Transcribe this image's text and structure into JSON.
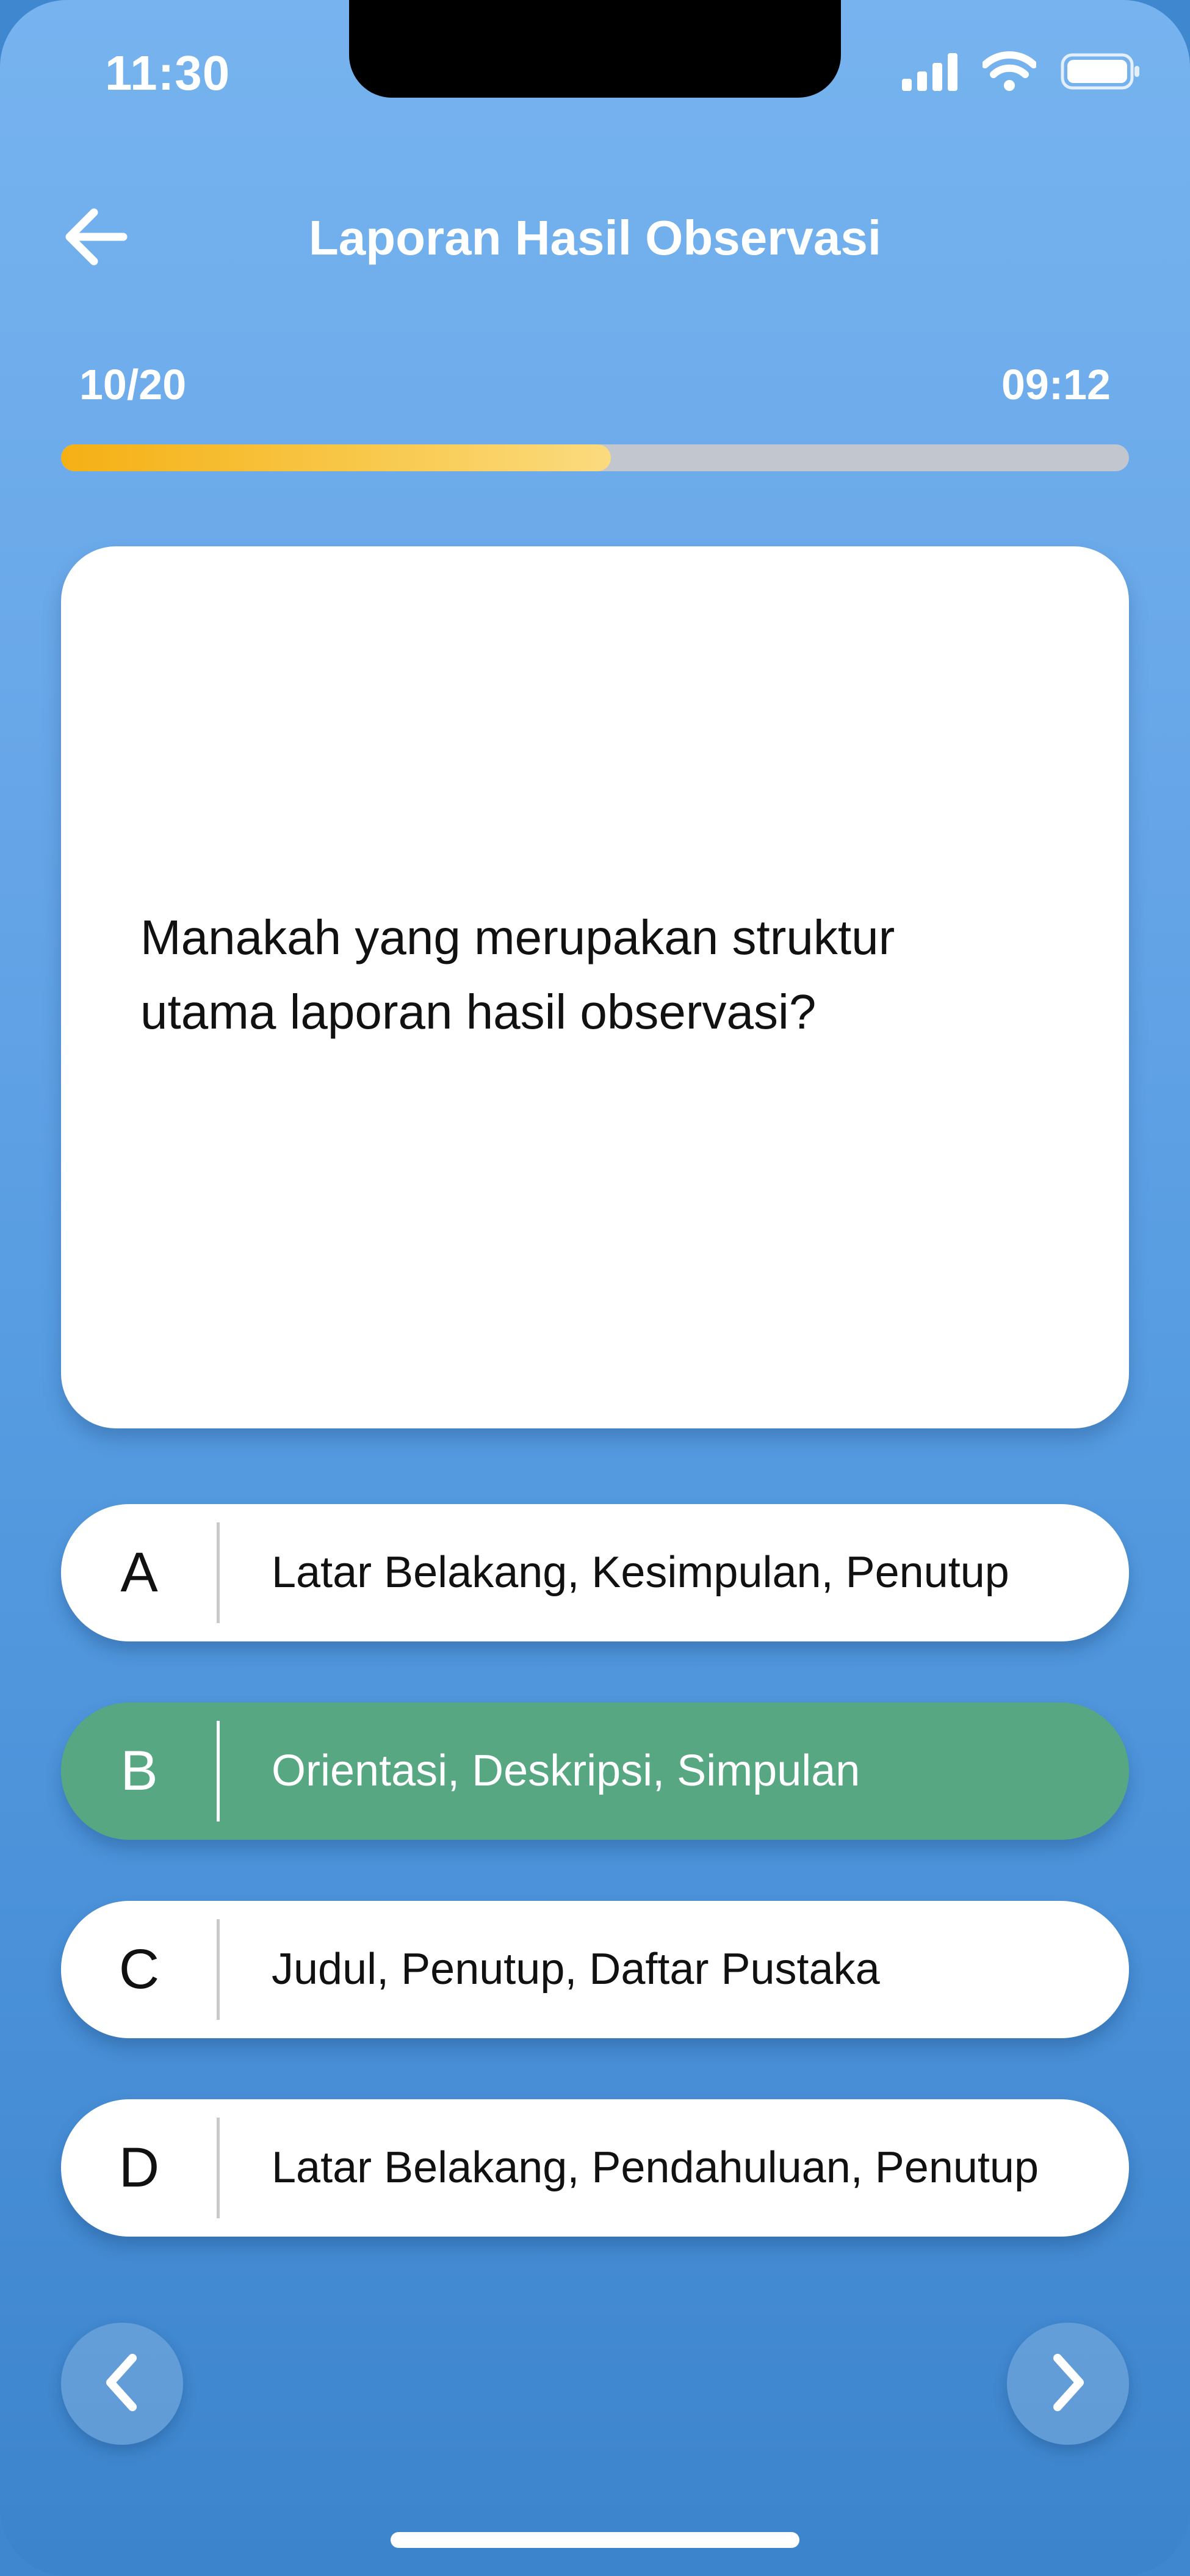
{
  "status_bar": {
    "time": "11:30"
  },
  "header": {
    "title": "Laporan Hasil Observasi",
    "back_icon": "arrow-left-icon"
  },
  "progress": {
    "counter": "10/20",
    "timer": "09:12",
    "fraction": 0.515,
    "fill_colors": [
      "#f5b014",
      "#fbdb7f"
    ],
    "track_color": "#c2c7cf"
  },
  "question": {
    "text": "Manakah yang merupakan struktur utama laporan hasil observasi?"
  },
  "options": [
    {
      "letter": "A",
      "text": "Latar Belakang, Kesimpulan, Penutup",
      "selected": false
    },
    {
      "letter": "B",
      "text": "Orientasi, Deskripsi, Simpulan",
      "selected": true
    },
    {
      "letter": "C",
      "text": "Judul, Penutup, Daftar Pustaka",
      "selected": false
    },
    {
      "letter": "D",
      "text": "Latar Belakang, Pendahuluan, Penutup",
      "selected": false
    }
  ],
  "navigation": {
    "prev_icon": "chevron-left-icon",
    "next_icon": "chevron-right-icon"
  },
  "colors": {
    "background_top": "#76b3ef",
    "background_bottom": "#3c84cc",
    "selected_option": "#57a882",
    "card": "#ffffff"
  }
}
